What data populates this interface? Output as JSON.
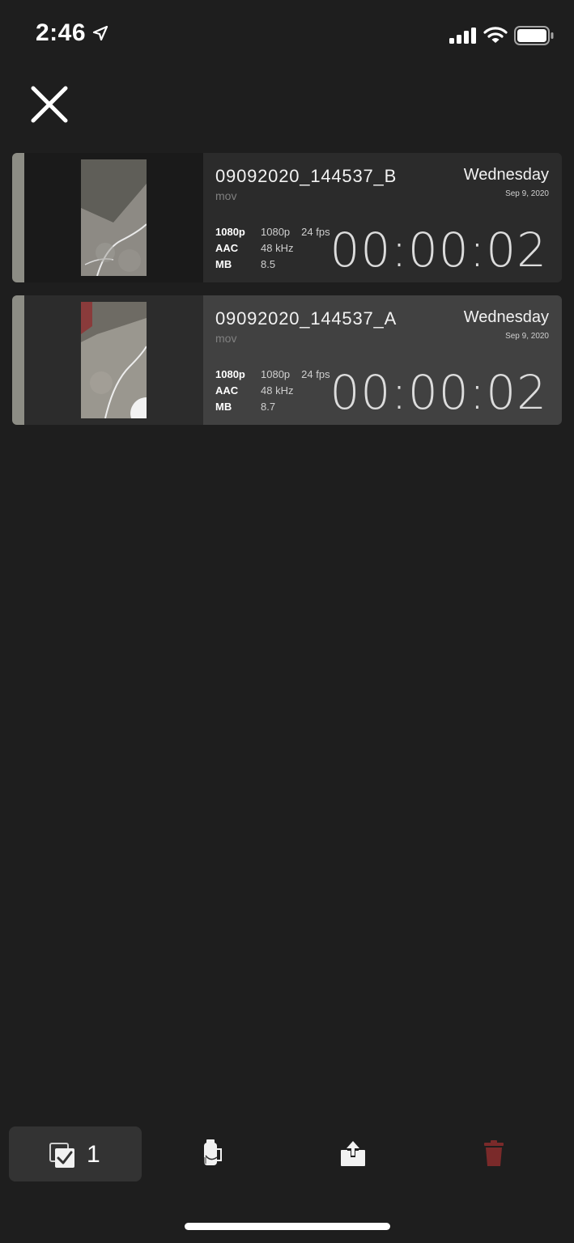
{
  "status_bar": {
    "time": "2:46",
    "icons": [
      "location-arrow-icon",
      "signal-icon",
      "wifi-icon",
      "battery-icon"
    ]
  },
  "header": {
    "close_icon": "close-icon"
  },
  "clips": [
    {
      "name": "09092020_144537_B",
      "ext": "mov",
      "day": "Wednesday",
      "date": "Sep 9, 2020",
      "meta": [
        {
          "key": "1080p",
          "value": "1080p",
          "extra": "24 fps"
        },
        {
          "key": "AAC",
          "value": "48 kHz",
          "extra": ""
        },
        {
          "key": "MB",
          "value": "8.5",
          "extra": ""
        }
      ],
      "duration": "00:00:02",
      "selected": false
    },
    {
      "name": "09092020_144537_A",
      "ext": "mov",
      "day": "Wednesday",
      "date": "Sep 9, 2020",
      "meta": [
        {
          "key": "1080p",
          "value": "1080p",
          "extra": "24 fps"
        },
        {
          "key": "AAC",
          "value": "48 kHz",
          "extra": ""
        },
        {
          "key": "MB",
          "value": "8.7",
          "extra": ""
        }
      ],
      "duration": "00:00:02",
      "selected": true
    }
  ],
  "toolbar": {
    "select_count": "1",
    "icons": [
      "select-checkbox-icon",
      "film-canister-icon",
      "share-icon",
      "trash-icon"
    ],
    "trash_color": "#7a2a2a"
  }
}
